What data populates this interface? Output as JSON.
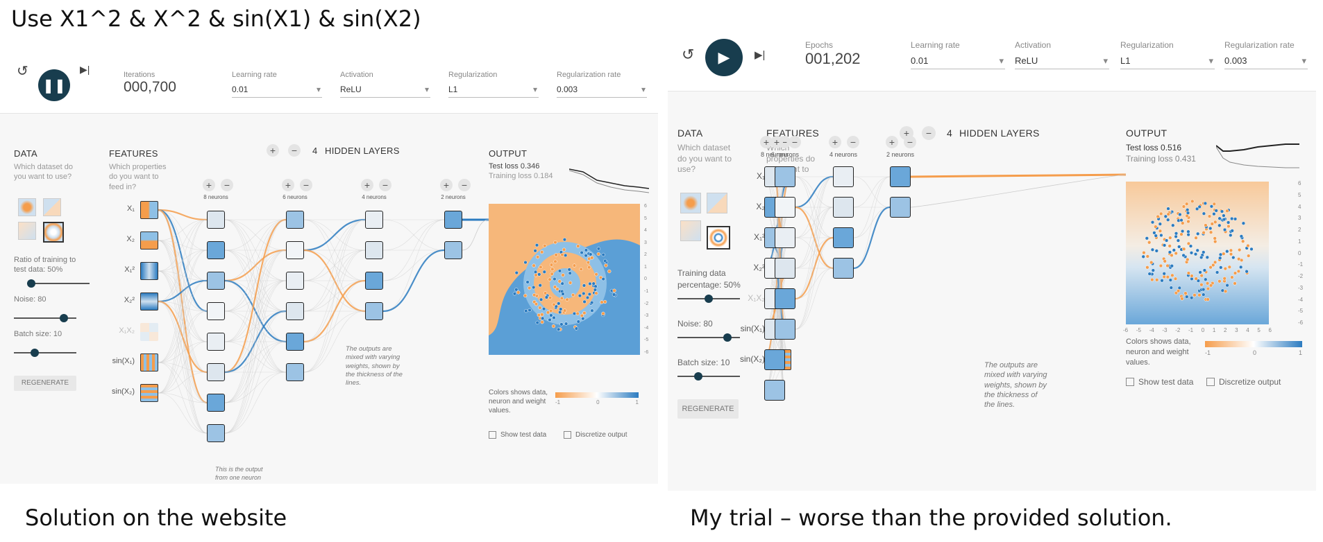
{
  "heading": "Use X1^2 & X^2 & sin(X1) & sin(X2)",
  "captions": {
    "left": "Solution on the website",
    "right": "My trial – worse than the provided solution."
  },
  "left": {
    "icons": [
      "reset-icon",
      "pause-icon",
      "step-forward-icon"
    ],
    "counter": {
      "label": "Iterations",
      "value": "000,700"
    },
    "learning_rate": {
      "label": "Learning rate",
      "value": "0.01"
    },
    "activation": {
      "label": "Activation",
      "value": "ReLU"
    },
    "regularization": {
      "label": "Regularization",
      "value": "L1"
    },
    "reg_rate": {
      "label": "Regularization rate",
      "value": "0.003"
    },
    "data": {
      "title": "DATA",
      "question": "Which dataset do you want to use?",
      "ratio": "Ratio of training to test data:  50%",
      "noise": "Noise:  80",
      "batch": "Batch size:  10",
      "regenerate": "REGENERATE",
      "ratio_value": 0.5,
      "noise_value": 0.8,
      "batch_value": 0.33
    },
    "features": {
      "title": "FEATURES",
      "question": "Which properties do you want to feed in?",
      "items": [
        "X₁",
        "X₂",
        "X₁²",
        "X₂²",
        "X₁X₂",
        "sin(X₁)",
        "sin(X₂)"
      ]
    },
    "hidden": {
      "count": "4",
      "title": "HIDDEN LAYERS",
      "plus": "+",
      "minus": "−",
      "neurons": [
        "8 neurons",
        "6 neurons",
        "4 neurons",
        "2 neurons"
      ]
    },
    "notes": {
      "outputs": "The outputs are mixed with varying weights, shown by the thickness of the lines.",
      "neuron": "This is the output from one neuron"
    },
    "output": {
      "title": "OUTPUT",
      "test_loss": "Test loss 0.346",
      "training_loss": "Training loss 0.184",
      "ticks": [
        "6",
        "5",
        "4",
        "3",
        "2",
        "1",
        "0",
        "-1",
        "-2",
        "-3",
        "-4",
        "-5",
        "-6"
      ]
    },
    "legend": {
      "text": "Colors shows data, neuron and weight values.",
      "min": "-1",
      "mid": "0",
      "max": "1"
    },
    "checks": {
      "show_test": "Show test data",
      "discretize": "Discretize output"
    }
  },
  "right": {
    "icons": [
      "reset-icon",
      "play-icon",
      "step-forward-icon"
    ],
    "counter": {
      "label": "Epochs",
      "value": "001,202"
    },
    "learning_rate": {
      "label": "Learning rate",
      "value": "0.01"
    },
    "activation": {
      "label": "Activation",
      "value": "ReLU"
    },
    "regularization": {
      "label": "Regularization",
      "value": "L1"
    },
    "reg_rate": {
      "label": "Regularization rate",
      "value": "0.003"
    },
    "data": {
      "title": "DATA",
      "question": "Which dataset do you want to use?",
      "ratio": "Training data percentage:  50%",
      "noise": "Noise:  80",
      "batch": "Batch size:  10",
      "regenerate": "REGENERATE",
      "ratio_value": 0.5,
      "noise_value": 0.8,
      "batch_value": 0.33
    },
    "features": {
      "title": "FEATURES",
      "question": "Which properties do you want to feed in?",
      "items": [
        "X₁",
        "X₂",
        "X₁²",
        "X₂²",
        "X₁X₂",
        "sin(X₁)",
        "sin(X₂)"
      ]
    },
    "hidden": {
      "count": "4",
      "title": "HIDDEN LAYERS",
      "plus": "+",
      "minus": "−",
      "neurons": [
        "8 neurons",
        "6 neurons",
        "4 neurons",
        "2 neurons"
      ]
    },
    "notes": {
      "outputs": "The outputs are mixed with varying weights, shown by the thickness of the lines."
    },
    "output": {
      "title": "OUTPUT",
      "test_loss": "Test loss 0.516",
      "training_loss": "Training loss 0.431",
      "ticks_y": [
        "6",
        "5",
        "4",
        "3",
        "2",
        "1",
        "0",
        "-1",
        "-2",
        "-3",
        "-4",
        "-5",
        "-6"
      ],
      "ticks_x": [
        "-6",
        "-5",
        "-4",
        "-3",
        "-2",
        "-1",
        "0",
        "1",
        "2",
        "3",
        "4",
        "5",
        "6"
      ]
    },
    "legend": {
      "text": "Colors shows data, neuron and weight values.",
      "min": "-1",
      "mid": "0",
      "max": "1"
    },
    "checks": {
      "show_test": "Show test data",
      "discretize": "Discretize output"
    }
  },
  "colors": {
    "orange": "#f59d4c",
    "blue": "#2b7bc0",
    "dark": "#183d4e"
  }
}
